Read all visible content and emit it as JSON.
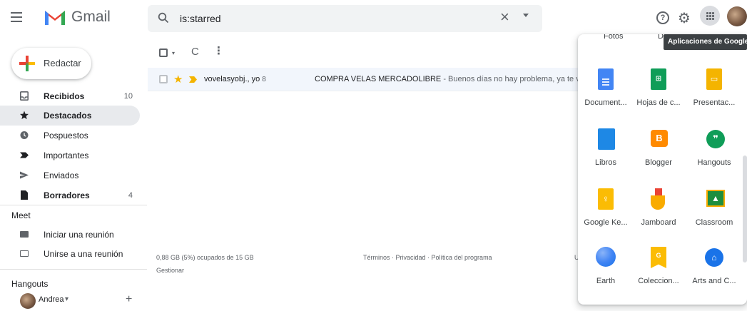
{
  "header": {
    "brand": "Gmail",
    "search_value": "is:starred",
    "clear_symbol": "×",
    "tooltip": "Aplicaciones de Google"
  },
  "compose": {
    "label": "Redactar"
  },
  "sidebar": {
    "items": [
      {
        "label": "Recibidos",
        "count": "10",
        "icon": "inbox-icon",
        "bold": true
      },
      {
        "label": "Destacados",
        "count": "",
        "icon": "star-icon",
        "bold": true,
        "active": true
      },
      {
        "label": "Pospuestos",
        "count": "",
        "icon": "clock-icon"
      },
      {
        "label": "Importantes",
        "count": "",
        "icon": "important-icon"
      },
      {
        "label": "Enviados",
        "count": "",
        "icon": "send-icon"
      },
      {
        "label": "Borradores",
        "count": "4",
        "icon": "draft-icon",
        "bold": true
      }
    ],
    "meet": {
      "title": "Meet",
      "items": [
        {
          "label": "Iniciar una reunión",
          "icon": "video-icon"
        },
        {
          "label": "Unirse a una reunión",
          "icon": "keyboard-icon"
        }
      ]
    },
    "hangouts": {
      "title": "Hangouts",
      "user": "Andrea",
      "caret": "▾",
      "add": "+"
    }
  },
  "toolbar": {
    "refresh": "C",
    "more": "⋮",
    "caret": "▾"
  },
  "mail": {
    "rows": [
      {
        "sender": "vovelasyobj., yo",
        "count": "8",
        "subject": "COMPRA VELAS MERCADOLIBRE",
        "snippet": " - Buenos días no hay problema, ya te volv"
      }
    ]
  },
  "footer": {
    "storage": "0,88 GB (5%) ocupados de 15 GB",
    "manage": "Gestionar",
    "links": "Términos · Privacidad · Política del programa",
    "truncated": "U"
  },
  "apps_panel": {
    "top_labels": [
      "Fotos",
      "D"
    ],
    "apps": [
      {
        "label": "Document...",
        "icon": "docs-icon",
        "color": "#4285f4"
      },
      {
        "label": "Hojas de c...",
        "icon": "sheets-icon",
        "color": "#0f9d58"
      },
      {
        "label": "Presentac...",
        "icon": "slides-icon",
        "color": "#f4b400"
      },
      {
        "label": "Libros",
        "icon": "books-icon",
        "color": "#1e88e5"
      },
      {
        "label": "Blogger",
        "icon": "blogger-icon",
        "color": "#ff8a00"
      },
      {
        "label": "Hangouts",
        "icon": "hangouts-icon",
        "color": "#0f9d58"
      },
      {
        "label": "Google Ke...",
        "icon": "keep-icon",
        "color": "#fbbc04"
      },
      {
        "label": "Jamboard",
        "icon": "jamboard-icon",
        "color": "#f9ab00"
      },
      {
        "label": "Classroom",
        "icon": "classroom-icon",
        "color": "#1e8e3e"
      },
      {
        "label": "Earth",
        "icon": "earth-icon",
        "color": "#4285f4"
      },
      {
        "label": "Coleccion...",
        "icon": "collections-icon",
        "color": "#fbbc04"
      },
      {
        "label": "Arts and C...",
        "icon": "arts-culture-icon",
        "color": "#1a73e8"
      }
    ]
  }
}
